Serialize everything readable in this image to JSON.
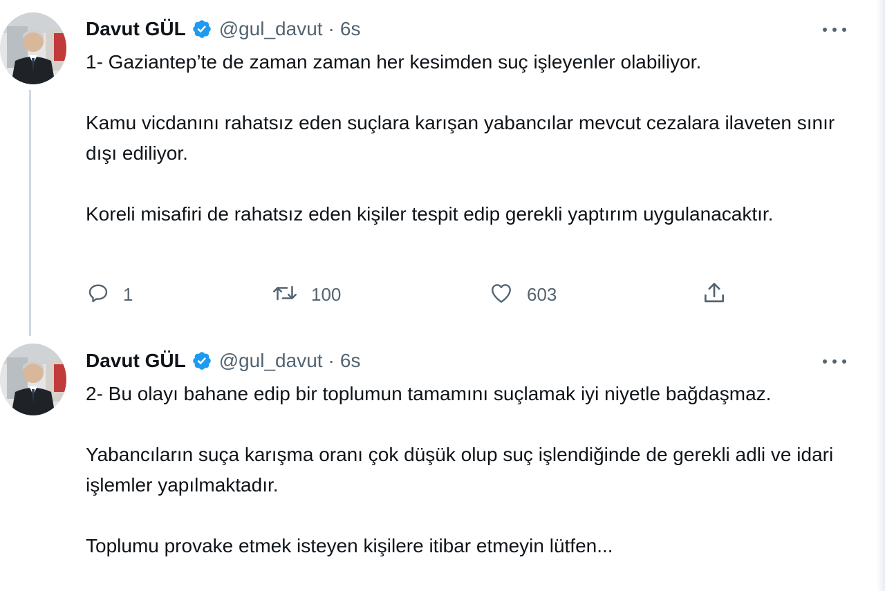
{
  "tweets": [
    {
      "author": {
        "name": "Davut GÜL",
        "handle": "@gul_davut",
        "verified": true,
        "avatar_icon": "profile-photo"
      },
      "separator": "·",
      "time": "6s",
      "paragraphs": [
        "1- Gaziantep’te de zaman zaman her kesimden suç işleyenler olabiliyor.",
        "Kamu vicdanını rahatsız eden suçlara karışan yabancılar mevcut cezalara ilaveten sınır dışı ediliyor.",
        "Koreli misafiri de rahatsız eden kişiler tespit edip gerekli yaptırım uygulanacaktır."
      ],
      "actions": {
        "reply": "1",
        "retweet": "100",
        "like": "603"
      }
    },
    {
      "author": {
        "name": "Davut GÜL",
        "handle": "@gul_davut",
        "verified": true,
        "avatar_icon": "profile-photo"
      },
      "separator": "·",
      "time": "6s",
      "paragraphs": [
        "2- Bu olayı bahane edip bir toplumun tamamını suçlamak iyi niyetle bağdaşmaz.",
        "Yabancıların suça karışma oranı çok düşük olup suç işlendiğinde de gerekli adli ve idari işlemler yapılmaktadır.",
        "Toplumu provake etmek isteyen kişilere itibar etmeyin lütfen..."
      ]
    }
  ],
  "colors": {
    "verified": "#1d9bf0",
    "secondary_text": "#536471",
    "primary_text": "#0f1419",
    "thread_line": "#cfd9de"
  },
  "icons": {
    "verified": "verified-badge-icon",
    "more": "more-icon",
    "reply": "reply-icon",
    "retweet": "retweet-icon",
    "like": "like-icon",
    "share": "share-icon"
  }
}
